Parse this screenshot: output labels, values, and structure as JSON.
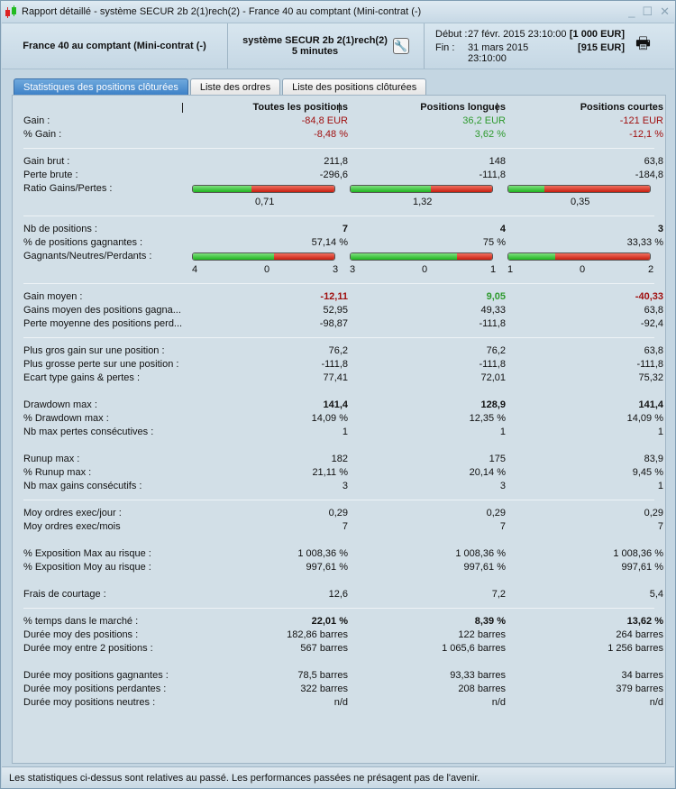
{
  "window": {
    "title": "Rapport détaillé - système SECUR 2b 2(1)rech(2) - France 40 au comptant (Mini-contrat  (-)",
    "app_icon": "candlestick-icon"
  },
  "header": {
    "instrument": "France 40 au comptant (Mini-contrat  (-)",
    "system": "système SECUR 2b 2(1)rech(2)",
    "timeframe": "5 minutes",
    "start_label": "Début :",
    "start_date": "27 févr. 2015 23:10:00",
    "start_capital": "[1 000 EUR]",
    "end_label": "Fin :",
    "end_date": "31 mars 2015 23:10:00",
    "end_capital": "[915 EUR]"
  },
  "tabs": [
    {
      "label": "Statistiques des positions clôturées",
      "active": true
    },
    {
      "label": "Liste des ordres"
    },
    {
      "label": "Liste des positions clôturées"
    }
  ],
  "columns": [
    "Toutes les positions",
    "Positions longues",
    "Positions courtes"
  ],
  "colors": {
    "negative": "#a01010",
    "positive": "#2e9a2e",
    "bar_green": "#1fb51f",
    "bar_red": "#c81e10"
  },
  "groups": [
    {
      "divider": true,
      "rows": [
        {
          "label": "Gain :",
          "values": [
            "-84,8 EUR",
            "36,2 EUR",
            "-121 EUR"
          ],
          "colors": [
            "red",
            "green",
            "red"
          ]
        },
        {
          "label": "% Gain :",
          "values": [
            "-8,48 %",
            "3,62 %",
            "-12,1 %"
          ],
          "colors": [
            "red",
            "green",
            "red"
          ]
        }
      ]
    },
    {
      "divider": true,
      "rows": [
        {
          "label": "Gain brut :",
          "values": [
            "211,8",
            "148",
            "63,8"
          ]
        },
        {
          "label": "Perte brute :",
          "values": [
            "-296,6",
            "-111,8",
            "-184,8"
          ]
        },
        {
          "label": "Ratio Gains/Pertes :",
          "bar": [
            0.417,
            0.57,
            0.257
          ],
          "bar_values": [
            "0,71",
            "1,32",
            "0,35"
          ]
        }
      ]
    },
    {
      "divider": true,
      "rows": [
        {
          "label": "Nb de positions :",
          "values": [
            "7",
            "4",
            "3"
          ],
          "bold": true
        },
        {
          "label": "% de positions gagnantes :",
          "values": [
            "57,14 %",
            "75 %",
            "33,33 %"
          ]
        },
        {
          "label": "Gagnants/Neutres/Perdants :",
          "bar": [
            0.5714,
            0.75,
            0.3333
          ],
          "bar_triples": [
            [
              "4",
              "0",
              "3"
            ],
            [
              "3",
              "0",
              "1"
            ],
            [
              "1",
              "0",
              "2"
            ]
          ]
        }
      ]
    },
    {
      "divider": true,
      "rows": [
        {
          "label": "Gain moyen :",
          "values": [
            "-12,11",
            "9,05",
            "-40,33"
          ],
          "colors": [
            "red",
            "green",
            "red"
          ],
          "bold": true
        },
        {
          "label": "Gains moyen des positions gagna...",
          "values": [
            "52,95",
            "49,33",
            "63,8"
          ]
        },
        {
          "label": "Perte moyenne des positions perd...",
          "values": [
            "-98,87",
            "-111,8",
            "-92,4"
          ]
        }
      ]
    },
    {
      "divider": false,
      "rows": [
        {
          "label": "Plus gros gain sur une position :",
          "values": [
            "76,2",
            "76,2",
            "63,8"
          ]
        },
        {
          "label": "Plus grosse perte sur une position :",
          "values": [
            "-111,8",
            "-111,8",
            "-111,8"
          ]
        },
        {
          "label": "Ecart type gains & pertes :",
          "values": [
            "77,41",
            "72,01",
            "75,32"
          ]
        }
      ]
    },
    {
      "divider": false,
      "rows": [
        {
          "label": "Drawdown max :",
          "values": [
            "141,4",
            "128,9",
            "141,4"
          ],
          "bold": true
        },
        {
          "label": "% Drawdown max :",
          "values": [
            "14,09 %",
            "12,35 %",
            "14,09 %"
          ]
        },
        {
          "label": "Nb max pertes consécutives :",
          "values": [
            "1",
            "1",
            "1"
          ]
        }
      ]
    },
    {
      "divider": true,
      "rows": [
        {
          "label": "Runup max :",
          "values": [
            "182",
            "175",
            "83,9"
          ]
        },
        {
          "label": "% Runup max :",
          "values": [
            "21,11 %",
            "20,14 %",
            "9,45 %"
          ]
        },
        {
          "label": "Nb max gains consécutifs :",
          "values": [
            "3",
            "3",
            "1"
          ]
        }
      ]
    },
    {
      "divider": false,
      "rows": [
        {
          "label": "Moy ordres exec/jour :",
          "values": [
            "0,29",
            "0,29",
            "0,29"
          ]
        },
        {
          "label": "Moy ordres exec/mois",
          "values": [
            "7",
            "7",
            "7"
          ]
        }
      ]
    },
    {
      "divider": false,
      "rows": [
        {
          "label": "% Exposition Max au risque :",
          "values": [
            "1 008,36 %",
            "1 008,36 %",
            "1 008,36 %"
          ]
        },
        {
          "label": "% Exposition Moy au risque :",
          "values": [
            "997,61 %",
            "997,61 %",
            "997,61 %"
          ]
        }
      ]
    },
    {
      "divider": true,
      "rows": [
        {
          "label": "Frais de courtage :",
          "values": [
            "12,6",
            "7,2",
            "5,4"
          ]
        }
      ]
    },
    {
      "divider": false,
      "rows": [
        {
          "label": "% temps dans le marché :",
          "values": [
            "22,01 %",
            "8,39 %",
            "13,62 %"
          ],
          "bold": true
        },
        {
          "label": "Durée moy des positions :",
          "values": [
            "182,86 barres",
            "122 barres",
            "264 barres"
          ]
        },
        {
          "label": "Durée moy entre 2 positions :",
          "values": [
            "567 barres",
            "1 065,6 barres",
            "1 256 barres"
          ]
        }
      ]
    },
    {
      "divider": false,
      "rows": [
        {
          "label": "Durée moy positions gagnantes :",
          "values": [
            "78,5 barres",
            "93,33 barres",
            "34 barres"
          ]
        },
        {
          "label": "Durée moy positions perdantes :",
          "values": [
            "322 barres",
            "208 barres",
            "379 barres"
          ]
        },
        {
          "label": "Durée moy positions neutres :",
          "values": [
            "n/d",
            "n/d",
            "n/d"
          ]
        }
      ]
    }
  ],
  "status": "Les statistiques ci-dessus sont relatives au passé. Les performances passées ne présagent pas de l'avenir."
}
